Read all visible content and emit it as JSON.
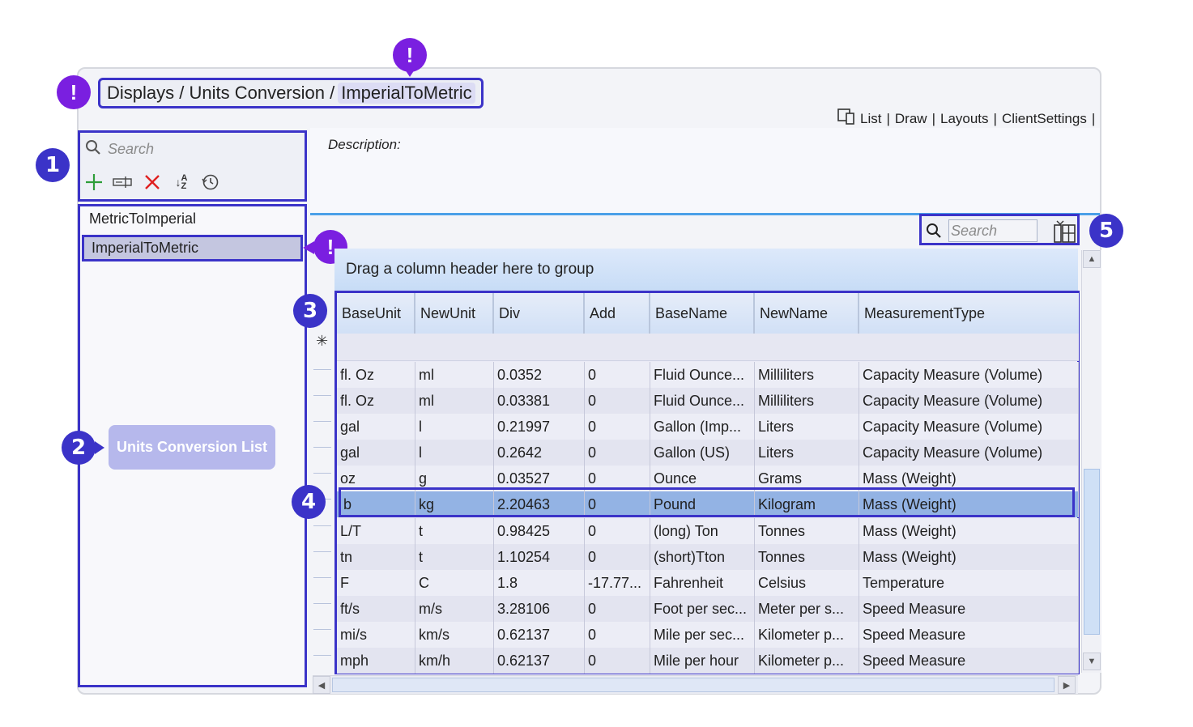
{
  "breadcrumb": {
    "part1": "Displays / Units Conversion /",
    "part2": "ImperialToMetric"
  },
  "toplinks": {
    "list": "List",
    "draw": "Draw",
    "layouts": "Layouts",
    "client_settings": "ClientSettings",
    "sep": "|"
  },
  "sidebar": {
    "search_placeholder": "Search",
    "items": [
      {
        "label": "MetricToImperial"
      },
      {
        "label": "ImperialToMetric",
        "selected": true
      }
    ],
    "empty_button": "Units Conversion List",
    "toolbar_icons": [
      "add-icon",
      "rename-icon",
      "delete-icon",
      "sort-icon",
      "history-icon"
    ]
  },
  "description_label": "Description:",
  "grid": {
    "search_placeholder": "Search",
    "group_hint": "Drag a column header here to group",
    "new_row_marker": "✳",
    "columns": [
      "BaseUnit",
      "NewUnit",
      "Div",
      "Add",
      "BaseName",
      "NewName",
      "MeasurementType"
    ],
    "rows": [
      [
        "fl. Oz",
        "ml",
        "0.0352",
        "0",
        "Fluid Ounce...",
        "Milliliters",
        "Capacity Measure (Volume)"
      ],
      [
        "fl. Oz",
        "ml",
        "0.03381",
        "0",
        "Fluid Ounce...",
        "Milliliters",
        "Capacity Measure (Volume)"
      ],
      [
        "gal",
        "l",
        "0.21997",
        "0",
        "Gallon (Imp...",
        "Liters",
        "Capacity Measure (Volume)"
      ],
      [
        "gal",
        "l",
        "0.2642",
        "0",
        "Gallon (US)",
        "Liters",
        "Capacity Measure (Volume)"
      ],
      [
        "oz",
        "g",
        "0.03527",
        "0",
        "Ounce",
        "Grams",
        "Mass (Weight)"
      ],
      [
        "b",
        "kg",
        "2.20463",
        "0",
        "Pound",
        "Kilogram",
        "Mass (Weight)"
      ],
      [
        "L/T",
        "t",
        "0.98425",
        "0",
        "(long) Ton",
        "Tonnes",
        "Mass (Weight)"
      ],
      [
        "tn",
        "t",
        "1.10254",
        "0",
        "(short)Tton",
        "Tonnes",
        "Mass (Weight)"
      ],
      [
        "F",
        "C",
        "1.8",
        "-17.77...",
        "Fahrenheit",
        "Celsius",
        "Temperature"
      ],
      [
        "ft/s",
        "m/s",
        "3.28106",
        "0",
        "Foot per sec...",
        "Meter per s...",
        "Speed Measure"
      ],
      [
        "mi/s",
        "km/s",
        "0.62137",
        "0",
        "Mile per sec...",
        "Kilometer p...",
        "Speed Measure"
      ],
      [
        "mph",
        "km/h",
        "0.62137",
        "0",
        "Mile per hour",
        "Kilometer p...",
        "Speed Measure"
      ]
    ],
    "selected_row_index": 5
  },
  "callouts": {
    "c1": "1",
    "c2": "2",
    "c3": "3",
    "c4": "4",
    "c5": "5",
    "warn": "!"
  },
  "colors": {
    "accent": "#3b33c8",
    "warning": "#7a1fe0",
    "selected_row": "#93b3e4"
  }
}
